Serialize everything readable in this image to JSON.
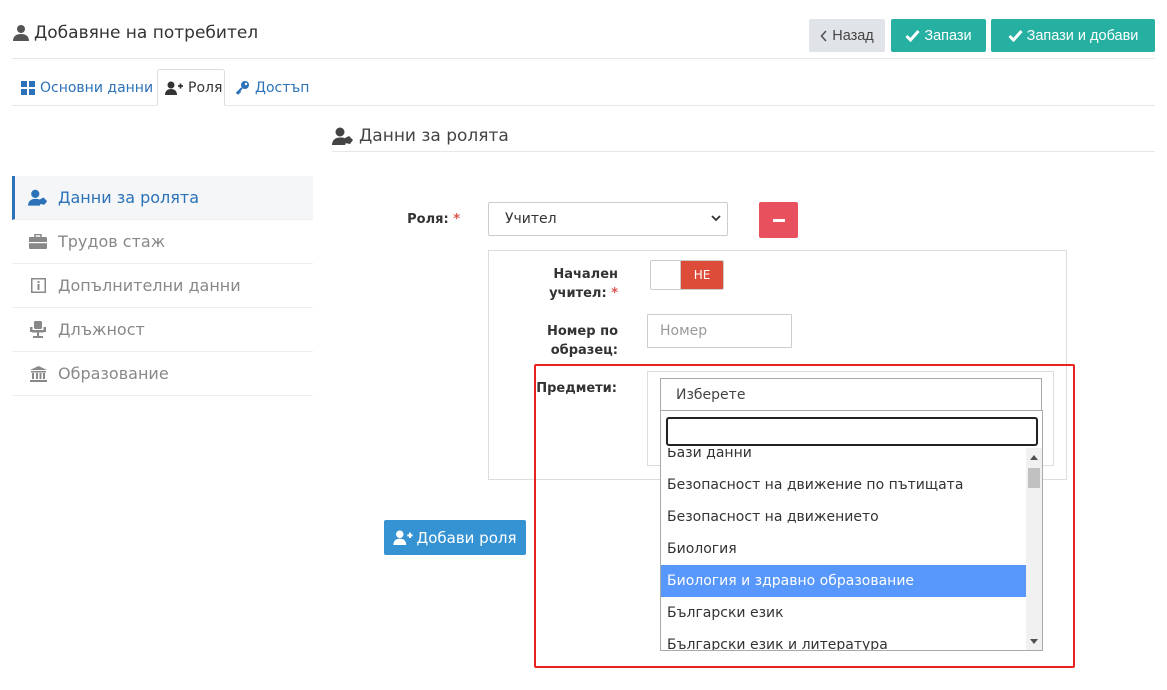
{
  "header": {
    "title": "Добавяне на потребител",
    "title_icon": "user-icon",
    "back_label": "Назад",
    "save_label": "Запази",
    "save_add_label": "Запази и добави"
  },
  "tabs": [
    {
      "label": "Основни данни",
      "icon": "grid-icon"
    },
    {
      "label": "Роля",
      "icon": "user-plus-icon",
      "active": true
    },
    {
      "label": "Достъп",
      "icon": "key-icon"
    }
  ],
  "section": {
    "title": "Данни за ролята",
    "icon": "user-tag-icon"
  },
  "sidebar": {
    "items": [
      {
        "label": "Данни за ролята",
        "icon": "user-tag-icon",
        "active": true
      },
      {
        "label": "Трудов стаж",
        "icon": "briefcase-icon"
      },
      {
        "label": "Допълнителни данни",
        "icon": "info-icon"
      },
      {
        "label": "Длъжност",
        "icon": "chair-icon"
      },
      {
        "label": "Образование",
        "icon": "university-icon"
      }
    ]
  },
  "form": {
    "role_label": "Роля:",
    "required_mark": "*",
    "role_value": "Учител",
    "initial_teacher_label_1": "Начален",
    "initial_teacher_label_2": "учител:",
    "toggle_state": "НЕ",
    "number_label_1": "Номер по",
    "number_label_2": "образец:",
    "number_placeholder": "Номер",
    "subjects_label": "Предмети:",
    "subjects_placeholder": "Изберете",
    "subjects_options": [
      "Бази данни",
      "Безопасност на движение по пътищата",
      "Безопасност на движението",
      "Биология",
      "Биология и здравно образование",
      "Български език",
      "Български език и литература"
    ],
    "highlighted_option_index": 4,
    "add_role_label": "Добави роля"
  },
  "colors": {
    "teal": "#26b0a1",
    "blue": "#3593d4",
    "link": "#2c72b8",
    "danger": "#e9505d",
    "toggle_off": "#dd4b39",
    "option_highlight": "#5897fb",
    "annotation": "#e8231f"
  }
}
